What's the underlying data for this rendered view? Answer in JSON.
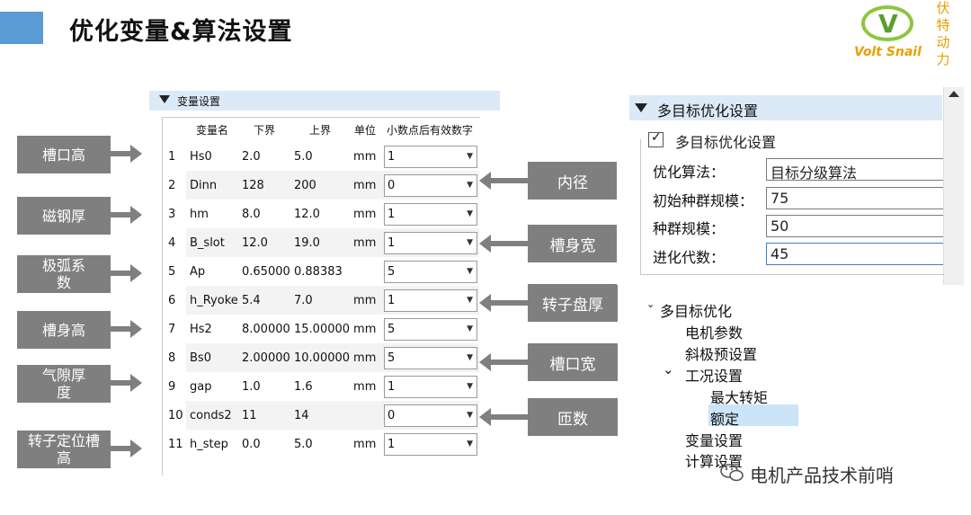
{
  "slide": {
    "title": "优化变量&算法设置",
    "logo": {
      "brand": "Volt Snail",
      "vertical_text": "伏特动力"
    },
    "watermark": "电机产品技术前哨"
  },
  "left_labels": [
    "槽口高",
    "磁钢厚",
    "极弧系数",
    "槽身高",
    "气隙厚度",
    "转子定位槽高"
  ],
  "right_labels": [
    "内径",
    "槽身宽",
    "转子盘厚",
    "槽口宽",
    "匝数"
  ],
  "variable_panel": {
    "header": "变量设置",
    "columns": [
      "变量名",
      "下界",
      "上界",
      "单位",
      "小数点后有效数字"
    ],
    "rows": [
      {
        "idx": "1",
        "name": "Hs0",
        "lower": "2.0",
        "upper": "5.0",
        "unit": "mm",
        "digits": "1"
      },
      {
        "idx": "2",
        "name": "Dinn",
        "lower": "128",
        "upper": "200",
        "unit": "mm",
        "digits": "0"
      },
      {
        "idx": "3",
        "name": "hm",
        "lower": "8.0",
        "upper": "12.0",
        "unit": "mm",
        "digits": "1"
      },
      {
        "idx": "4",
        "name": "B_slot",
        "lower": "12.0",
        "upper": "19.0",
        "unit": "mm",
        "digits": "1"
      },
      {
        "idx": "5",
        "name": "Ap",
        "lower": "0.65000",
        "upper": "0.88383",
        "unit": "",
        "digits": "5"
      },
      {
        "idx": "6",
        "name": "h_Ryoke",
        "lower": "5.4",
        "upper": "7.0",
        "unit": "mm",
        "digits": "1"
      },
      {
        "idx": "7",
        "name": "Hs2",
        "lower": "8.00000",
        "upper": "15.00000",
        "unit": "mm",
        "digits": "5"
      },
      {
        "idx": "8",
        "name": "Bs0",
        "lower": "2.00000",
        "upper": "10.00000",
        "unit": "mm",
        "digits": "5"
      },
      {
        "idx": "9",
        "name": "gap",
        "lower": "1.0",
        "upper": "1.6",
        "unit": "mm",
        "digits": "1"
      },
      {
        "idx": "10",
        "name": "conds2",
        "lower": "11",
        "upper": "14",
        "unit": "",
        "digits": "0"
      },
      {
        "idx": "11",
        "name": "h_step",
        "lower": "0.0",
        "upper": "5.0",
        "unit": "mm",
        "digits": "1"
      }
    ]
  },
  "multi_objective_panel": {
    "header": "多目标优化设置",
    "checkbox_label": "多目标优化设置",
    "checkbox_checked": true,
    "fields": [
      {
        "label": "优化算法：",
        "value": "目标分级算法"
      },
      {
        "label": "初始种群规模：",
        "value": "75"
      },
      {
        "label": "种群规模：",
        "value": "50"
      },
      {
        "label": "进化代数：",
        "value": "45"
      }
    ]
  },
  "tree": {
    "root": "多目标优化",
    "items": [
      "电机参数",
      "斜极预设置"
    ],
    "group": "工况设置",
    "group_children": [
      "最大转矩",
      "额定"
    ],
    "selected": "额定",
    "tail_items": [
      "变量设置",
      "计算设置"
    ]
  },
  "colors": {
    "accent_blue": "#5b9bd5",
    "label_gray": "#7f7f7f",
    "header_blue": "#dce9f7",
    "selection": "#cce4f7"
  }
}
